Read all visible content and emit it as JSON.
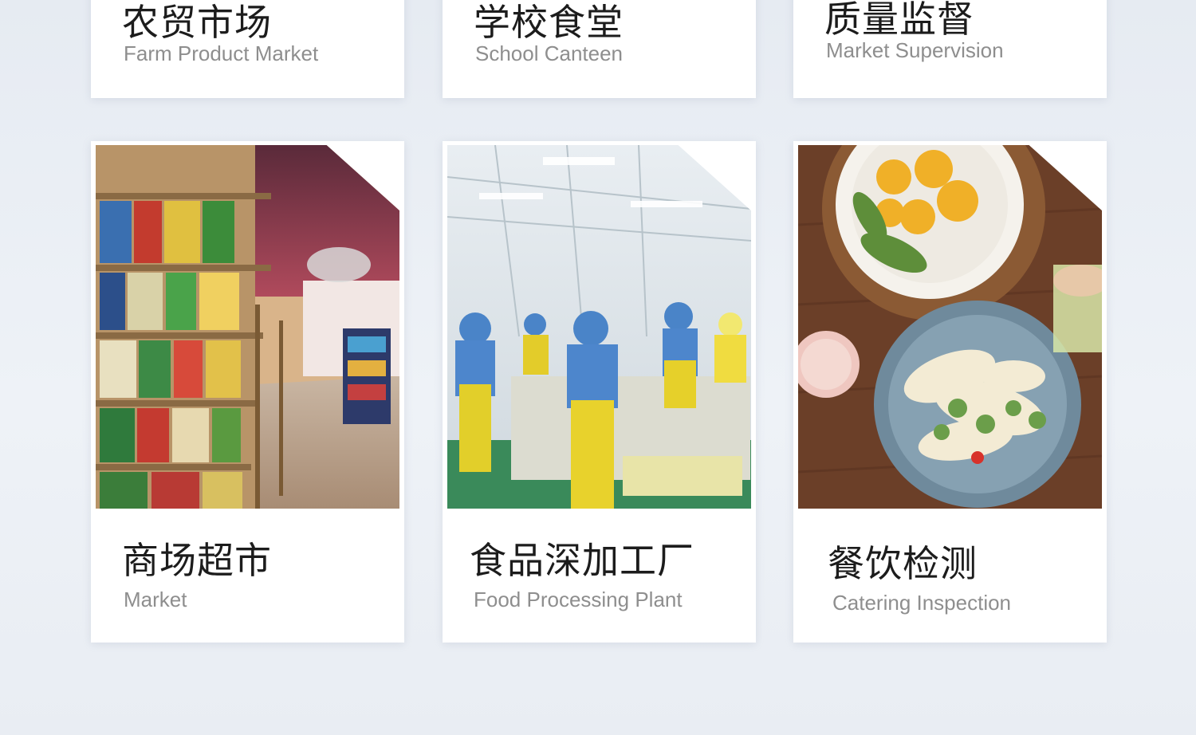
{
  "top_row": [
    {
      "title_cn": "农贸市场",
      "title_en": "Farm Product Market"
    },
    {
      "title_cn": "学校食堂",
      "title_en": "School Canteen"
    },
    {
      "title_cn": "质量监督",
      "title_en": "Market Supervision"
    }
  ],
  "bottom_row": [
    {
      "title_cn": "商场超市",
      "title_en": "Market"
    },
    {
      "title_cn": "食品深加工厂",
      "title_en": "Food Processing Plant"
    },
    {
      "title_cn": "餐饮检测",
      "title_en": "Catering Inspection"
    }
  ]
}
